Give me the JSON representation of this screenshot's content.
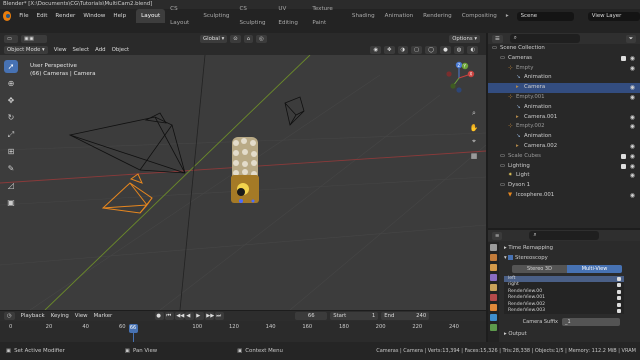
{
  "window": {
    "title": "Blender* [X:\\Documents\\CG\\Tutorials\\MultiCam2.blend]"
  },
  "menu": [
    "File",
    "Edit",
    "Render",
    "Window",
    "Help"
  ],
  "workspaces": [
    "Layout",
    "CS Layout",
    "Sculpting",
    "CS Sculpting",
    "UV Editing",
    "Texture Paint",
    "Shading",
    "Animation",
    "Rendering",
    "Compositing"
  ],
  "scene": "Scene",
  "view_layer": "View Layer",
  "toolrow": {
    "orientation": "Global",
    "options": "Options"
  },
  "viewport_header": {
    "mode": "Object Mode",
    "items": [
      "View",
      "Select",
      "Add",
      "Object"
    ]
  },
  "viewport_info": {
    "line1": "User Perspective",
    "line2": "(66) Cameras | Camera"
  },
  "gizmo": {
    "x": "X",
    "y": "Y",
    "z": "Z"
  },
  "outliner": {
    "rows": [
      {
        "name": "Scene Collection",
        "indent": 0,
        "icon": "collection",
        "eye": false
      },
      {
        "name": "Cameras",
        "indent": 1,
        "icon": "collection",
        "eye": true,
        "chk": true
      },
      {
        "name": "Empty",
        "indent": 2,
        "icon": "empty",
        "eye": true,
        "dim": true
      },
      {
        "name": "Animation",
        "indent": 3,
        "icon": "action",
        "eye": false
      },
      {
        "name": "Camera",
        "indent": 3,
        "icon": "camera",
        "eye": true,
        "selected": true
      },
      {
        "name": "Empty.001",
        "indent": 2,
        "icon": "empty",
        "eye": true,
        "dim": true
      },
      {
        "name": "Animation",
        "indent": 3,
        "icon": "action",
        "eye": false
      },
      {
        "name": "Camera.001",
        "indent": 3,
        "icon": "camera",
        "eye": true
      },
      {
        "name": "Empty.002",
        "indent": 2,
        "icon": "empty",
        "eye": true,
        "dim": true
      },
      {
        "name": "Animation",
        "indent": 3,
        "icon": "action",
        "eye": false
      },
      {
        "name": "Camera.002",
        "indent": 3,
        "icon": "camera",
        "eye": true
      },
      {
        "name": "Scale Cubes",
        "indent": 1,
        "icon": "collection",
        "eye": true,
        "chk": true,
        "dim": true
      },
      {
        "name": "Lighting",
        "indent": 1,
        "icon": "collection",
        "eye": true,
        "chk": true
      },
      {
        "name": "Light",
        "indent": 2,
        "icon": "light",
        "eye": true
      },
      {
        "name": "Dyson 1",
        "indent": 1,
        "icon": "collection",
        "eye": false
      },
      {
        "name": "Icosphere.001",
        "indent": 2,
        "icon": "mesh",
        "eye": true
      }
    ]
  },
  "properties": {
    "sections": [
      "Time Remapping",
      "Stereoscopy"
    ],
    "stereo_tabs": [
      "Stereo 3D",
      "Multi-View"
    ],
    "views": [
      "left",
      "right",
      "RenderView.00",
      "RenderView.001",
      "RenderView.002",
      "RenderView.003"
    ],
    "camera_suffix_label": "Camera Suffix",
    "camera_suffix_value": "_1",
    "output_label": "Output"
  },
  "timeline": {
    "header": [
      "Playback",
      "Keying",
      "View",
      "Marker"
    ],
    "current_frame": "66",
    "start_label": "Start",
    "start_value": "1",
    "end_label": "End",
    "end_value": "240",
    "ticks": [
      "0",
      "20",
      "40",
      "60",
      "66",
      "100",
      "120",
      "140",
      "160",
      "180",
      "200",
      "220",
      "240"
    ]
  },
  "statusbar": {
    "left": "Set Active Modifier",
    "mid1": "Pan View",
    "mid2": "Context Menu",
    "right": "Cameras | Camera | Verts:13,394 | Faces:15,326 | Tris:28,338 | Objects:1/5 | Memory: 112.2 MiB | VRAM"
  },
  "colors": {
    "accent": "#4772b3",
    "selected": "#e8871e",
    "grid_x": "#8b3a3a",
    "grid_y": "#6b8a2a"
  }
}
